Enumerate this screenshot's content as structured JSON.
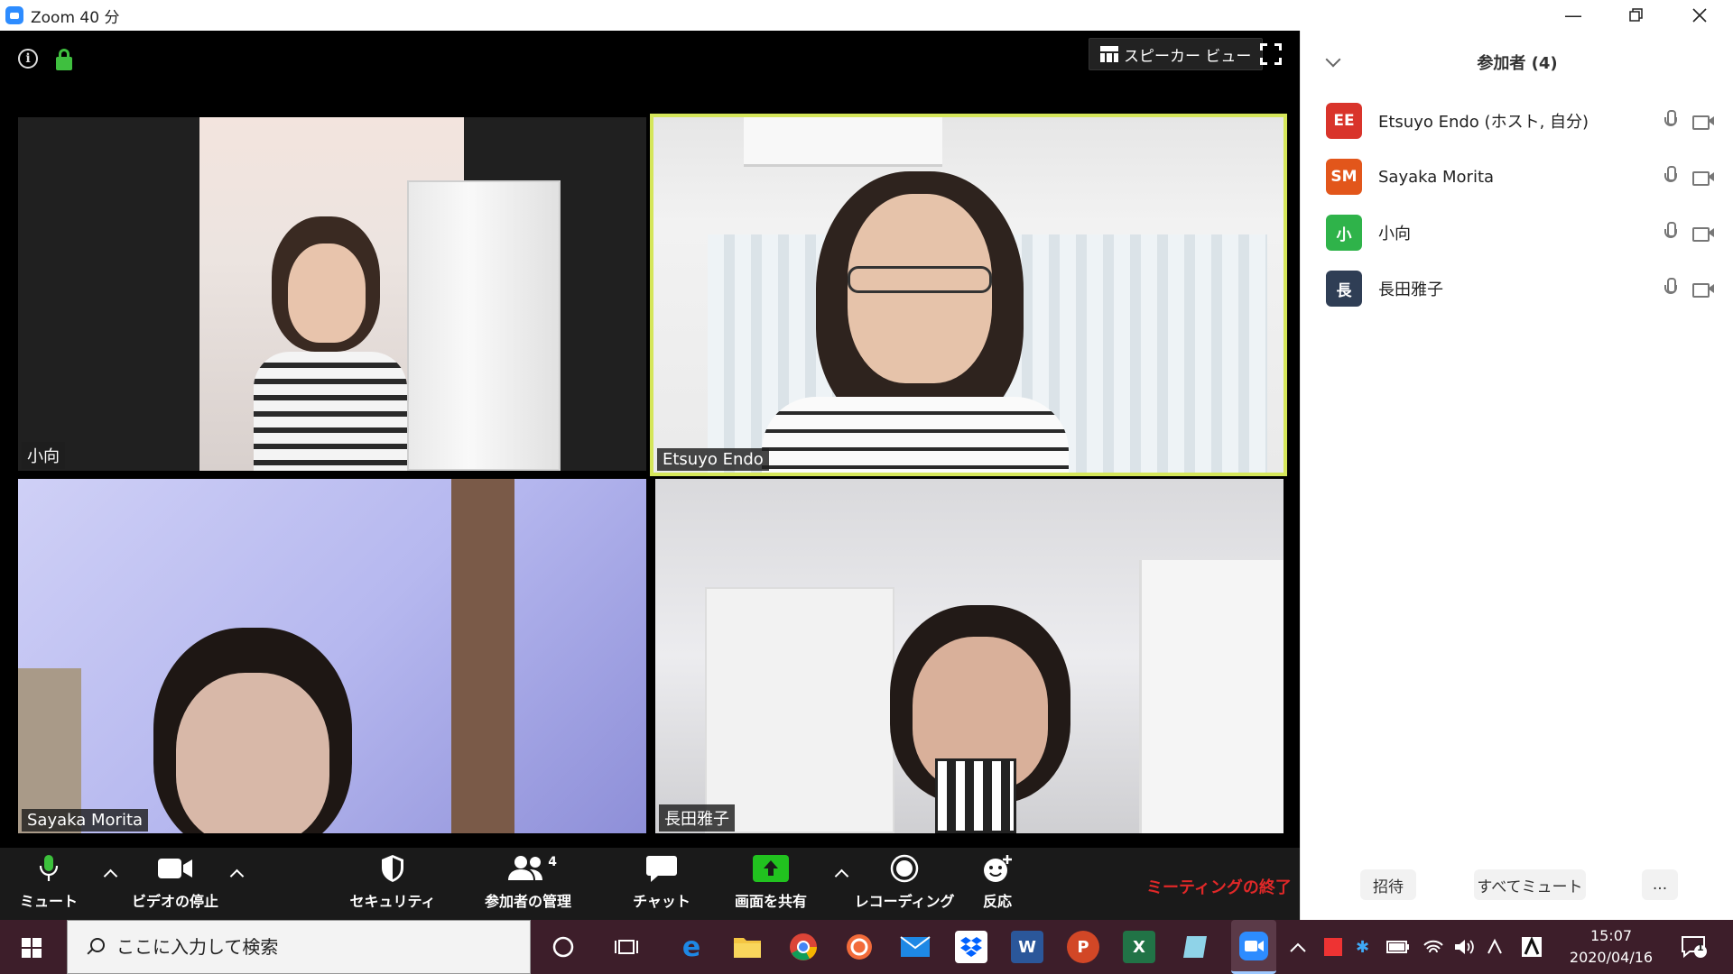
{
  "window": {
    "title": "Zoom 40 分"
  },
  "meeting": {
    "view_button": "スピーカー ビュー",
    "tiles": [
      {
        "name": "小向"
      },
      {
        "name": "Etsuyo Endo"
      },
      {
        "name": "Sayaka Morita"
      },
      {
        "name": "長田雅子"
      }
    ]
  },
  "toolbar": {
    "mute": "ミュート",
    "stop_video": "ビデオの停止",
    "security": "セキュリティ",
    "manage_participants": "参加者の管理",
    "participant_count": "4",
    "chat": "チャット",
    "share_screen": "画面を共有",
    "recording": "レコーディング",
    "reactions": "反応",
    "end_meeting": "ミーティングの終了"
  },
  "participants_panel": {
    "title": "参加者 (4)",
    "participants": [
      {
        "initials": "EE",
        "name": "Etsuyo Endo (ホスト, 自分)",
        "color": "#d9342b"
      },
      {
        "initials": "SM",
        "name": "Sayaka Morita",
        "color": "#e2561b"
      },
      {
        "initials": "小",
        "name": "小向",
        "color": "#2fb34a"
      },
      {
        "initials": "長",
        "name": "長田雅子",
        "color": "#2f3e55"
      }
    ],
    "invite": "招待",
    "mute_all": "すべてミュート",
    "more": "..."
  },
  "taskbar": {
    "search_placeholder": "ここに入力して検索",
    "time": "15:07",
    "date": "2020/04/16",
    "notification_count": "1"
  }
}
